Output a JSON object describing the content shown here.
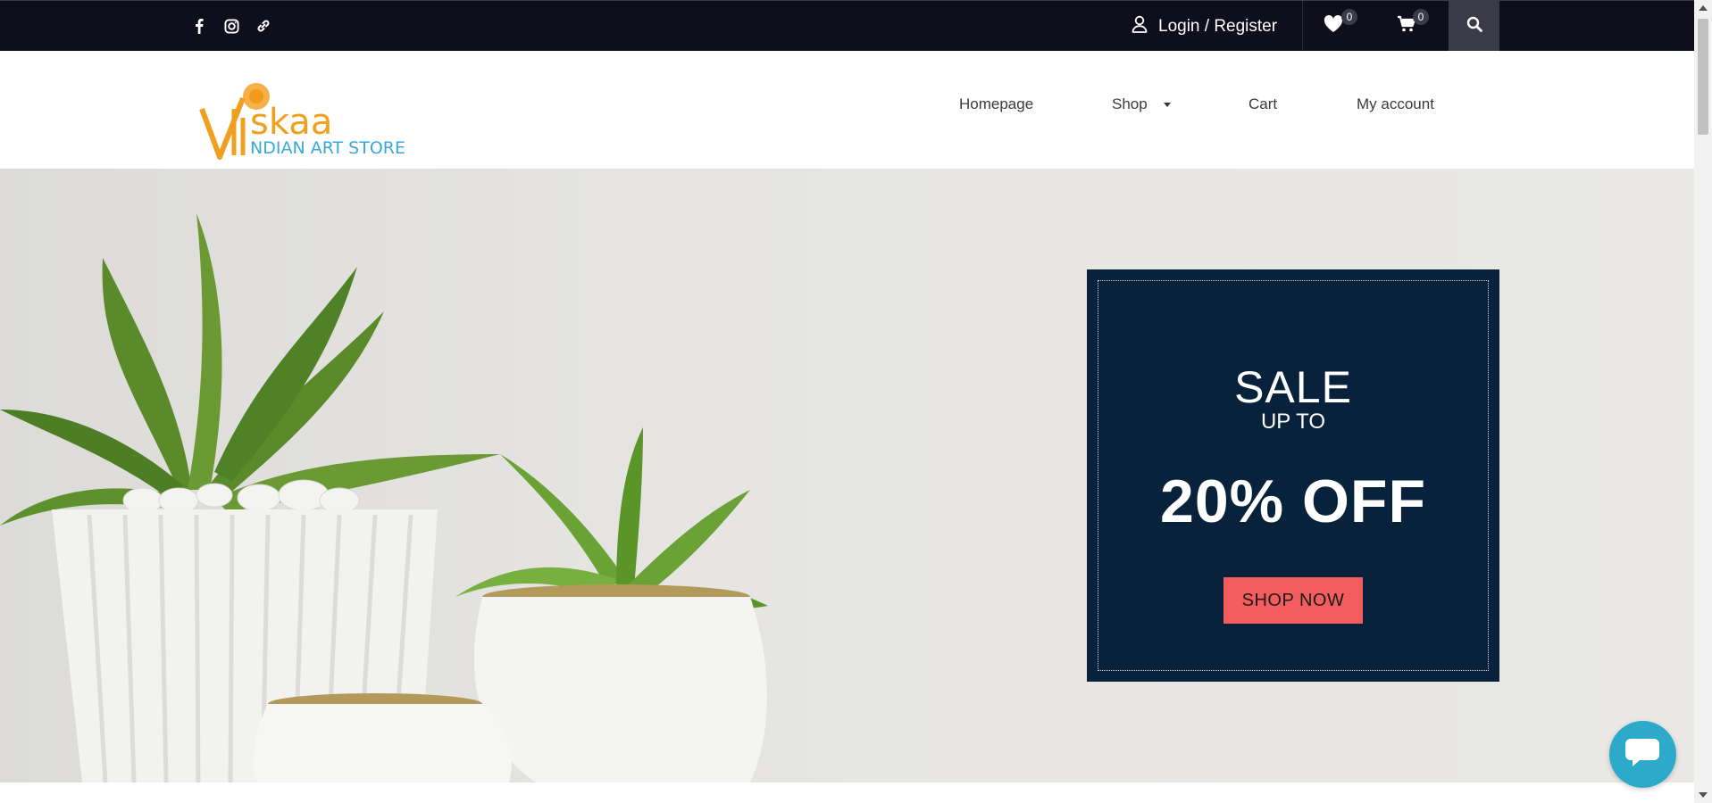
{
  "topbar": {
    "social_icons": [
      "facebook-icon",
      "instagram-icon",
      "link-icon"
    ],
    "login_label": "Login / Register",
    "wishlist_count": "0",
    "cart_count": "0"
  },
  "header": {
    "logo_text": "Viskaa",
    "logo_subtext": "INDIAN ART STORE",
    "nav": {
      "homepage": "Homepage",
      "shop": "Shop",
      "cart": "Cart",
      "account": "My account"
    }
  },
  "hero": {
    "sale": "SALE",
    "upto": "UP TO",
    "discount": "20% OFF",
    "cta": "SHOP NOW"
  },
  "colors": {
    "topbar_bg": "#0f0e1d",
    "promo_bg": "#07223a",
    "cta_bg": "#f45d5d",
    "chat_bg": "#2da9c9",
    "logo_orange": "#f0a020",
    "logo_blue": "#3aa8d8"
  }
}
